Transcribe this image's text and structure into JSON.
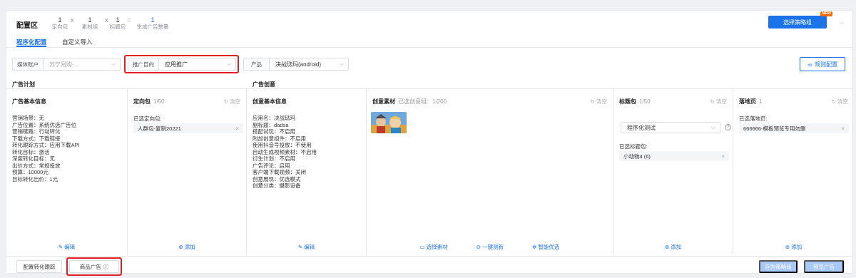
{
  "header": {
    "title": "配置区",
    "counts": [
      {
        "num": "1",
        "label": "定向包"
      },
      {
        "num": "1",
        "label": "素材组"
      },
      {
        "num": "1",
        "label": "标题包"
      },
      {
        "num": "1",
        "label": "生成广告数量"
      }
    ],
    "ops": [
      "x",
      "x",
      "x",
      "="
    ],
    "select_strategy_label": "选择策略组",
    "new_badge": "NEW"
  },
  "tabs": [
    {
      "label": "程序化配置",
      "active": true
    },
    {
      "label": "自定义导入",
      "active": false
    }
  ],
  "filters": {
    "media_account": {
      "label": "媒体账户",
      "value": "苏宁易购-..."
    },
    "promo_goal": {
      "label": "推广目的",
      "value": "应用推广"
    },
    "product": {
      "label": "产品",
      "value": "决战琺玛(android)"
    }
  },
  "rule_config_label": "规则配置",
  "sections": {
    "plan": "广告计划",
    "creative": "广告创意"
  },
  "columns": {
    "ad_info": {
      "title": "广告基本信息",
      "lines": [
        "营销场景：无",
        "广告位置：系统优选广告位",
        "营销链路：行动转化",
        "下载方式：下载链接",
        "转化跟踪方式：应用下载API",
        "转化目标：激活",
        "深度转化目标：无",
        "出价方式：常规投放",
        "预算：10000元",
        "目标转化出价：1元"
      ],
      "footer": "编辑"
    },
    "targeting": {
      "title": "定向包",
      "count": "1/50",
      "clear": "清空",
      "selected_label": "已选定向包:",
      "chip": "人群包-复制20221",
      "footer": "添加"
    },
    "creative_info": {
      "title": "创意基本信息",
      "lines": [
        "应用名：决战琺玛",
        "副标题：dadsa",
        "搭配试玩：不启用",
        "附加创意组件：不启用",
        "使用抖音号投放：不使用",
        "自动生成视频素材：不启用",
        "衍生计划：不启用",
        "广告评论：启用",
        "客户端下载视频：关闭",
        "创意展现：优选模式",
        "创意分类：摄影设备"
      ],
      "footer": "编辑"
    },
    "material": {
      "title": "创意素材",
      "sub": "已选创意组：1/200",
      "clear": "清空",
      "footers": [
        "选择素材",
        "一键测新",
        "智能优选"
      ]
    },
    "titles": {
      "title": "标题包",
      "count": "1/50",
      "clear": "清空",
      "select_value": "程序化测试",
      "selected_label": "已选标题包:",
      "chip": "小动物4 (6)",
      "footer": "添加"
    },
    "landing": {
      "title": "落地页",
      "count": "1",
      "clear": "清空",
      "selected_label": "已选落地页:",
      "chip": "666666-模板预览专用勿删",
      "footer": "添加"
    }
  },
  "footer": {
    "conversion_tracking": "配置转化跟踪",
    "product_ad": "商品广告",
    "save_strategy": "存为策略组",
    "preview_ad": "预览广告"
  },
  "colors": {
    "accent": "#1a73e8",
    "highlight": "#e02020",
    "disabled": "#a8c9f5"
  }
}
